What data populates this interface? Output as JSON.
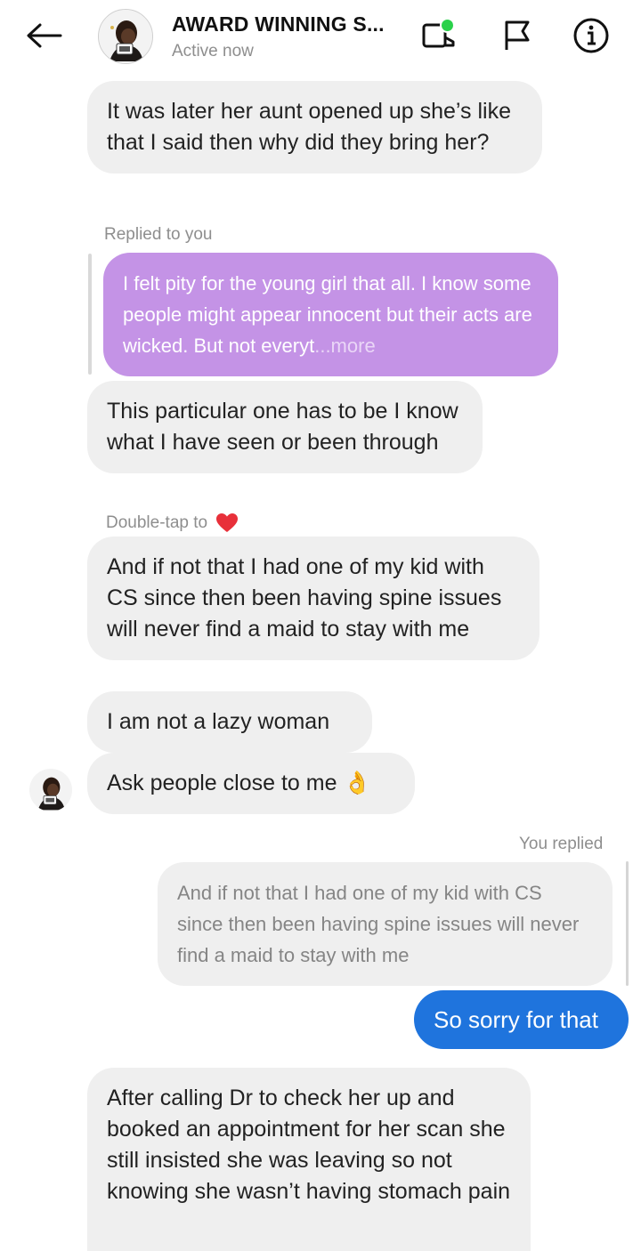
{
  "header": {
    "title": "AWARD WINNING S...",
    "status": "Active now",
    "online_color": "#2ad14a",
    "icons": [
      "arrow-left-icon",
      "video-call-icon",
      "flag-icon",
      "info-icon"
    ]
  },
  "messages": {
    "m1": "It was later her aunt opened up she’s like that I said then why did they bring her?",
    "reply_label_1": "Replied to you",
    "quoted_1_text": "I felt pity for the young girl that all. I know some people might appear innocent but their acts are wicked. But not everyt",
    "quoted_1_more": "...more",
    "m2": "This particular one has to be I know what I have seen or been through",
    "double_tap_label": "Double-tap to",
    "m3": "And if not that I had one of my kid with CS since then been having spine issues will never find a maid to stay with me",
    "m4": "I am not a lazy woman",
    "m5_text": "Ask people close to me",
    "m5_emoji": "👌",
    "reply_label_2": "You replied",
    "quoted_2_text": "And if not that I had one of my kid with CS since then been having spine issues will never find a maid to stay with me",
    "out1": "So sorry for that",
    "m6": "After calling Dr to check her up and booked an appointment for her scan she still insisted she was leaving so not knowing she wasn’t having stomach pain"
  },
  "colors": {
    "incoming_bubble": "#efefef",
    "outgoing_bubble": "#1f74dd",
    "quoted_reply_bubble": "#c493e6",
    "heart": "#e8303a"
  }
}
